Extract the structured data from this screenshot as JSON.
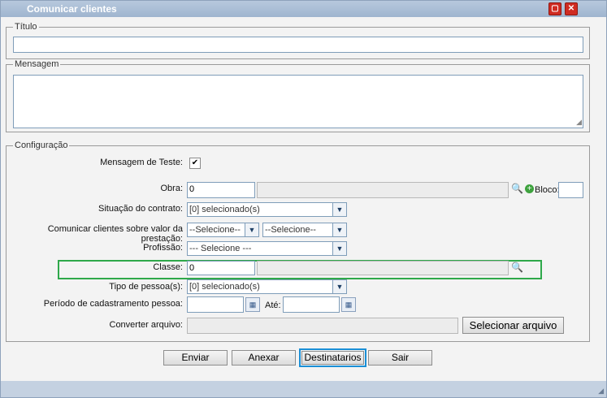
{
  "window": {
    "title": "Comunicar clientes"
  },
  "fields": {
    "titulo_legend": "Título",
    "mensagem_legend": "Mensagem",
    "config_legend": "Configuração"
  },
  "config": {
    "test_label": "Mensagem de Teste:",
    "obra_label": "Obra:",
    "obra_value": "0",
    "bloco_label": "Bloco:",
    "situacao_label": "Situação do contrato:",
    "situacao_value": "[0] selecionado(s)",
    "comunicar_label": "Comunicar clientes sobre valor da prestação:",
    "comunicar_value1": "--Selecione--",
    "comunicar_value2": "--Selecione--",
    "profissao_label": "Profissão:",
    "profissao_value": "--- Selecione ---",
    "classe_label": "Classe:",
    "classe_value": "0",
    "tipo_label": "Tipo de pessoa(s):",
    "tipo_value": "[0] selecionado(s)",
    "periodo_label": "Período de cadastramento pessoa:",
    "ate_label": "Até:",
    "converter_label": "Converter arquivo:",
    "selecionar_label": "Selecionar arquivo"
  },
  "buttons": {
    "enviar": "Enviar",
    "anexar": "Anexar",
    "destinatarios": "Destinatarios",
    "sair": "Sair"
  },
  "colors": {
    "highlight_green": "#2ea84a",
    "highlight_blue": "#1a8fd6",
    "title_bar": "#a9bdd6"
  }
}
